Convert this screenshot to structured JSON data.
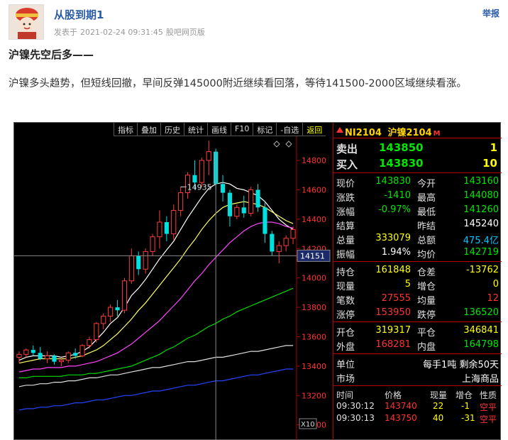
{
  "post": {
    "author": "从股到期1",
    "posted_label": "发表于",
    "datetime": "2021-02-24 09:31:45",
    "source": "股吧网页版",
    "report": "举报",
    "title": "沪镍先空后多——",
    "body": "沪镍多头趋势，但短线回撤，早间反弹145000附近继续看回落，等待141500-2000区域继续看涨。"
  },
  "toolbar": [
    "指标",
    "叠加",
    "历史",
    "统计",
    "画线",
    "F10",
    "标记",
    "-自选",
    "返回"
  ],
  "chart_data": {
    "type": "candlestick",
    "ylim": [
      12950,
      14950
    ],
    "y_ticks": [
      13000,
      13200,
      13400,
      13600,
      13800,
      14000,
      14200,
      14400,
      14600,
      14800
    ],
    "y_tick_labels": [
      "13000",
      "13200",
      "13400",
      "13600",
      "13800",
      "14000",
      "14200",
      "14400",
      "14600",
      "14800"
    ],
    "crosshair_value": "14151",
    "crosshair_y": 14151,
    "crosshair_index": 28,
    "peak_label": "14935",
    "peak_index": 23,
    "zoom": "X10",
    "candles": [
      [
        13460,
        13500,
        13420,
        13480
      ],
      [
        13480,
        13520,
        13460,
        13510
      ],
      [
        13510,
        13540,
        13470,
        13490
      ],
      [
        13490,
        13530,
        13440,
        13450
      ],
      [
        13450,
        13500,
        13420,
        13470
      ],
      [
        13470,
        13480,
        13410,
        13430
      ],
      [
        13430,
        13460,
        13400,
        13440
      ],
      [
        13440,
        13500,
        13420,
        13490
      ],
      [
        13490,
        13520,
        13450,
        13470
      ],
      [
        13470,
        13550,
        13460,
        13540
      ],
      [
        13540,
        13600,
        13520,
        13580
      ],
      [
        13580,
        13700,
        13560,
        13690
      ],
      [
        13690,
        13760,
        13650,
        13740
      ],
      [
        13740,
        13820,
        13700,
        13800
      ],
      [
        13800,
        13850,
        13740,
        13780
      ],
      [
        13780,
        14000,
        13760,
        13980
      ],
      [
        13980,
        14200,
        13960,
        14150
      ],
      [
        14150,
        14180,
        14020,
        14060
      ],
      [
        14060,
        14200,
        14030,
        14180
      ],
      [
        14180,
        14300,
        14150,
        14280
      ],
      [
        14280,
        14460,
        14200,
        14380
      ],
      [
        14380,
        14420,
        14250,
        14300
      ],
      [
        14300,
        14500,
        14260,
        14460
      ],
      [
        14460,
        14620,
        14420,
        14580
      ],
      [
        14580,
        14720,
        14540,
        14700
      ],
      [
        14700,
        14800,
        14600,
        14650
      ],
      [
        14650,
        14820,
        14620,
        14800
      ],
      [
        14800,
        14935,
        14700,
        14860
      ],
      [
        14860,
        14880,
        14600,
        14640
      ],
      [
        14640,
        14700,
        14520,
        14580
      ],
      [
        14580,
        14600,
        14350,
        14420
      ],
      [
        14420,
        14500,
        14400,
        14480
      ],
      [
        14480,
        14560,
        14410,
        14440
      ],
      [
        14440,
        14620,
        14420,
        14600
      ],
      [
        14600,
        14640,
        14450,
        14480
      ],
      [
        14480,
        14520,
        14240,
        14300
      ],
      [
        14300,
        14320,
        14150,
        14180
      ],
      [
        14180,
        14250,
        14100,
        14220
      ],
      [
        14220,
        14290,
        14180,
        14270
      ],
      [
        14270,
        14350,
        14230,
        14330
      ]
    ],
    "ma_lines": [
      {
        "color": "#ffffff",
        "values": [
          13440,
          13460,
          13470,
          13470,
          13470,
          13470,
          13460,
          13470,
          13480,
          13500,
          13530,
          13580,
          13630,
          13690,
          13730,
          13800,
          13880,
          13930,
          13990,
          14060,
          14130,
          14190,
          14250,
          14330,
          14410,
          14480,
          14550,
          14610,
          14640,
          14650,
          14640,
          14610,
          14600,
          14580,
          14560,
          14520,
          14460,
          14400,
          14360,
          14330
        ]
      },
      {
        "color": "#ffff66",
        "values": [
          13420,
          13430,
          13440,
          13450,
          13450,
          13450,
          13450,
          13450,
          13460,
          13470,
          13490,
          13510,
          13540,
          13580,
          13620,
          13670,
          13720,
          13780,
          13830,
          13890,
          13950,
          14010,
          14070,
          14130,
          14200,
          14260,
          14330,
          14390,
          14440,
          14480,
          14500,
          14510,
          14520,
          14510,
          14500,
          14480,
          14450,
          14420,
          14390,
          14370
        ]
      },
      {
        "color": "#ff44ff",
        "values": [
          13360,
          13370,
          13380,
          13380,
          13390,
          13390,
          13390,
          13400,
          13400,
          13410,
          13420,
          13430,
          13450,
          13470,
          13490,
          13520,
          13550,
          13590,
          13630,
          13670,
          13710,
          13760,
          13810,
          13860,
          13920,
          13980,
          14030,
          14090,
          14140,
          14190,
          14240,
          14280,
          14320,
          14350,
          14370,
          14380,
          14380,
          14370,
          14350,
          14340
        ]
      },
      {
        "color": "#00dd00",
        "values": [
          13320,
          13320,
          13330,
          13330,
          13330,
          13330,
          13330,
          13340,
          13340,
          13340,
          13350,
          13350,
          13360,
          13370,
          13380,
          13390,
          13400,
          13420,
          13440,
          13460,
          13480,
          13510,
          13530,
          13560,
          13590,
          13610,
          13640,
          13670,
          13690,
          13720,
          13740,
          13770,
          13790,
          13810,
          13830,
          13850,
          13870,
          13890,
          13910,
          13930
        ]
      },
      {
        "color": "#dddddd",
        "values": [
          13260,
          13270,
          13270,
          13280,
          13280,
          13290,
          13290,
          13300,
          13300,
          13310,
          13320,
          13320,
          13330,
          13340,
          13340,
          13350,
          13360,
          13370,
          13380,
          13390,
          13390,
          13400,
          13410,
          13420,
          13430,
          13430,
          13440,
          13450,
          13460,
          13460,
          13470,
          13480,
          13490,
          13500,
          13500,
          13510,
          13520,
          13530,
          13540,
          13540
        ]
      },
      {
        "color": "#2244ff",
        "values": [
          13100,
          13110,
          13110,
          13120,
          13120,
          13130,
          13130,
          13140,
          13150,
          13150,
          13160,
          13170,
          13170,
          13180,
          13190,
          13200,
          13200,
          13210,
          13220,
          13230,
          13230,
          13240,
          13250,
          13260,
          13270,
          13270,
          13280,
          13290,
          13300,
          13300,
          13310,
          13320,
          13330,
          13340,
          13340,
          13350,
          13360,
          13370,
          13380,
          13380
        ]
      }
    ]
  },
  "quote": {
    "code": "NI2104",
    "name": "沪镍2104",
    "flag": "M",
    "sell_label": "卖出",
    "sell_price": "143850",
    "sell_qty": "1",
    "buy_label": "买入",
    "buy_price": "143830",
    "buy_qty": "10",
    "rows1": [
      {
        "l1": "现价",
        "v1": "143830",
        "c1": "green",
        "l2": "今开",
        "v2": "143160",
        "c2": "green"
      },
      {
        "l1": "涨跌",
        "v1": "-1410",
        "c1": "green",
        "l2": "最高",
        "v2": "144080",
        "c2": "green"
      },
      {
        "l1": "涨幅",
        "v1": "-0.97%",
        "c1": "green",
        "l2": "最低",
        "v2": "141260",
        "c2": "green"
      },
      {
        "l1": "结算",
        "v1": "",
        "c1": "white",
        "l2": "昨结",
        "v2": "145240",
        "c2": "white"
      },
      {
        "l1": "总量",
        "v1": "333079",
        "c1": "yellow",
        "l2": "总额",
        "v2": "475.4亿",
        "c2": "cyan"
      },
      {
        "l1": "振幅",
        "v1": "1.94%",
        "c1": "white",
        "l2": "均价",
        "v2": "142719",
        "c2": "green"
      }
    ],
    "rows2": [
      {
        "l1": "持仓",
        "v1": "161848",
        "c1": "yellow",
        "l2": "仓差",
        "v2": "-13762",
        "c2": "yellow"
      },
      {
        "l1": "现量",
        "v1": "5",
        "c1": "yellow",
        "l2": "增仓",
        "v2": "0",
        "c2": "yellow"
      },
      {
        "l1": "笔数",
        "v1": "27555",
        "c1": "red",
        "l2": "均量",
        "v2": "12",
        "c2": "red"
      },
      {
        "l1": "涨停",
        "v1": "153950",
        "c1": "red",
        "l2": "跌停",
        "v2": "136520",
        "c2": "green"
      }
    ],
    "rows3": [
      {
        "l1": "开仓",
        "v1": "319317",
        "c1": "yellow",
        "l2": "平仓",
        "v2": "346841",
        "c2": "yellow"
      },
      {
        "l1": "外盘",
        "v1": "168281",
        "c1": "red",
        "l2": "内盘",
        "v2": "164798",
        "c2": "green"
      }
    ],
    "unit_label": "单位",
    "unit_value": "每手1吨 剩余50天",
    "market_label": "市场",
    "market_value": "上海商品",
    "trades_header": [
      "时间",
      "价格",
      "现量",
      "增仓",
      "性质"
    ],
    "trades": [
      {
        "time": "09:30:12",
        "price": "143740",
        "qty": "22",
        "chg": "-1",
        "type": "空平"
      },
      {
        "time": "09:30:13",
        "price": "143750",
        "qty": "40",
        "chg": "-31",
        "type": "空平"
      }
    ]
  }
}
